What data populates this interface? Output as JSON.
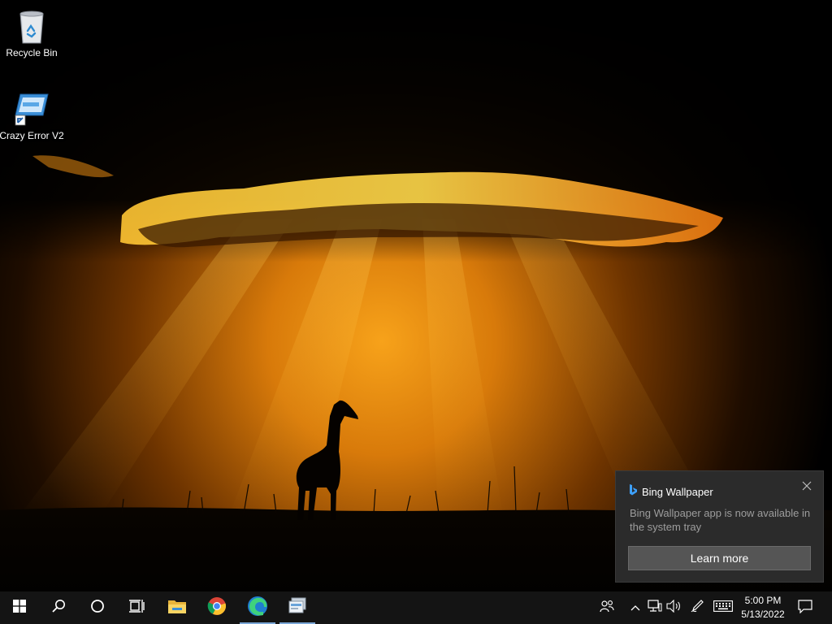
{
  "desktop": {
    "icons": [
      {
        "label": "Recycle Bin",
        "icon": "recycle-bin-icon"
      },
      {
        "label": "Crazy Error V2",
        "icon": "app-shortcut-icon"
      }
    ]
  },
  "toast": {
    "app_name": "Bing Wallpaper",
    "message": "Bing Wallpaper app is now available in the system tray",
    "button_label": "Learn more",
    "close_icon": "close-icon"
  },
  "taskbar": {
    "buttons": [
      {
        "icon": "windows-start-icon"
      },
      {
        "icon": "search-icon"
      },
      {
        "icon": "cortana-icon"
      },
      {
        "icon": "task-view-icon"
      },
      {
        "icon": "file-explorer-icon"
      },
      {
        "icon": "chrome-icon"
      },
      {
        "icon": "edge-icon",
        "active": true
      },
      {
        "icon": "app-window-icon",
        "active": true
      }
    ],
    "tray": {
      "icons": [
        "people-icon",
        "chevron-up-icon",
        "network-icon",
        "volume-icon",
        "pen-icon",
        "keyboard-icon",
        "notification-icon"
      ],
      "time": "5:00 PM",
      "date": "5/13/2022"
    }
  },
  "colors": {
    "taskbar": "#141414",
    "toast_bg": "#2b2b2b",
    "accent": "#7aa6d6"
  }
}
